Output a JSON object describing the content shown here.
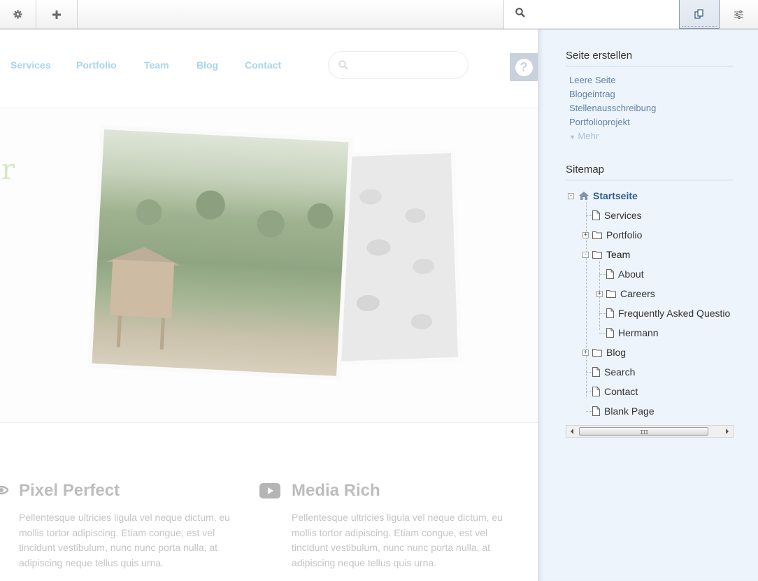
{
  "toolbar": {
    "gear_icon": "gear-icon",
    "add_icon": "plus-icon",
    "search_icon": "search-icon",
    "search_value": "",
    "pages_icon": "pages-icon",
    "settings_icon": "sliders-icon"
  },
  "site": {
    "nav": [
      "Services",
      "Portfolio",
      "Team",
      "Blog",
      "Contact"
    ],
    "search_value": "",
    "help_label": "?",
    "hero_fragment": "r",
    "features": [
      {
        "icon": "eye-icon",
        "title": "Pixel Perfect",
        "text": "Pellentesque ultricies ligula vel neque dictum, eu mollis tortor adipiscing. Etiam congue, est vel tincidunt vestibulum, nunc nunc porta nulla, at adipiscing neque tellus quis urna."
      },
      {
        "icon": "play-icon",
        "title": "Media Rich",
        "text": "Pellentesque ultricies ligula vel neque dictum, eu mollis tortor adipiscing. Etiam congue, est vel tincidunt vestibulum, nunc nunc porta nulla, at adipiscing neque tellus quis urna."
      }
    ]
  },
  "panel": {
    "create_heading": "Seite erstellen",
    "create_links": [
      "Leere Seite",
      "Blogeintrag",
      "Stellenausschreibung",
      "Portfolioprojekt"
    ],
    "more_label": "Mehr",
    "sitemap_heading": "Sitemap",
    "tree": [
      {
        "label": "Startseite",
        "type": "home",
        "toggle": "-"
      },
      {
        "label": "Services",
        "type": "page",
        "toggle": ""
      },
      {
        "label": "Portfolio",
        "type": "folder",
        "toggle": "+"
      },
      {
        "label": "Team",
        "type": "folder",
        "toggle": "-"
      },
      {
        "label": "About",
        "type": "page",
        "toggle": ""
      },
      {
        "label": "Careers",
        "type": "folder",
        "toggle": "+"
      },
      {
        "label": "Frequently Asked Questio",
        "type": "page",
        "toggle": ""
      },
      {
        "label": "Hermann",
        "type": "page",
        "toggle": ""
      },
      {
        "label": "Blog",
        "type": "folder",
        "toggle": "+"
      },
      {
        "label": "Search",
        "type": "page",
        "toggle": ""
      },
      {
        "label": "Contact",
        "type": "page",
        "toggle": ""
      },
      {
        "label": "Blank Page",
        "type": "page",
        "toggle": ""
      }
    ],
    "scroll_grip": "III"
  },
  "colors": {
    "nav_link": "#a8d4f0",
    "panel_bg": "#eef4fb",
    "panel_link": "#5d83a8",
    "tree_root": "#2e5d8d"
  }
}
